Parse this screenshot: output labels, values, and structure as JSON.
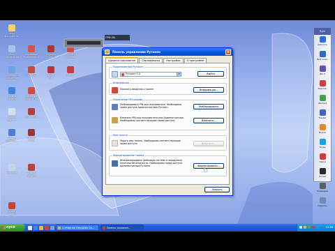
{
  "desktop_icons": [
    {
      "label": "Мои",
      "label2": "документы",
      "icon": "my-documents-icon",
      "color": "#f2d46b"
    },
    {
      "label": "Мой",
      "label2": "компьютер",
      "icon": "my-computer-icon",
      "color": "#a9c2e8"
    },
    {
      "label": "Сетевое",
      "label2": "окружение",
      "icon": "network-icon",
      "color": "#6ea3e0"
    },
    {
      "label": "Internet",
      "label2": "Explorer",
      "icon": "internet-explorer-icon",
      "color": "#3a84e6"
    },
    {
      "label": "Поиск",
      "label2": "сертиф.",
      "icon": "search-certificate-icon",
      "color": "#d9dfe7"
    },
    {
      "label": "Add or",
      "label2": "Remove...",
      "icon": "add-remove-icon",
      "color": "#4d7cd6"
    },
    {
      "label": "Корзина",
      "label2": "",
      "icon": "recycle-bin-icon",
      "color": "#c7d3e3"
    },
    {
      "label": "Rutoken",
      "label2": "Admin",
      "icon": "rutoken-icon",
      "color": "#c94236"
    },
    {
      "label": "Установка",
      "label2": "RutokenAdm",
      "icon": "rutoken-install-icon",
      "color": "#d7553e"
    },
    {
      "label": "Rutoken",
      "label2": "CSP",
      "icon": "rutoken-csp-icon",
      "color": "#a63a33"
    },
    {
      "label": "Установка",
      "label2": "КриптоПро",
      "icon": "cryptopro-icon",
      "color": "#d44a3a"
    },
    {
      "label": "Rutoken",
      "label2": "Drv",
      "icon": "rutoken-driver-icon",
      "color": "#b2383a"
    },
    {
      "label": "Сертиф.",
      "label2": "",
      "icon": "certificate-icon",
      "color": "#c44b40"
    },
    {
      "label": "КриптоПро",
      "label2": "",
      "icon": "cryptopro-csp-icon",
      "color": "#b73b3b"
    },
    {
      "label": "Rutoken",
      "label2": "PKCS",
      "icon": "rutoken-pkcs-icon",
      "color": "#9b3536"
    },
    {
      "label": "ПО для",
      "label2": "Rutoken",
      "icon": "rutoken-software-icon",
      "color": "#ba4039"
    },
    {
      "label": "Rutoken",
      "label2": "Drivers",
      "icon": "rutoken-drivers2-icon",
      "color": "#cc4d3f"
    },
    {
      "label": "PuTTY",
      "label2": "",
      "icon": "putty-icon",
      "color": "#c23c3b"
    }
  ],
  "dock": {
    "title": "Пуск",
    "items": [
      {
        "label": "Autoruns",
        "icon": "autoruns-icon",
        "color": "#2b6fd6"
      },
      {
        "label": "Мой комп.",
        "icon": "computer-icon",
        "color": "#2c69c9"
      },
      {
        "label": "Rar 3",
        "icon": "rar-icon",
        "color": "#6b4ea8"
      },
      {
        "label": "Daemon",
        "icon": "daemon-tools-icon",
        "color": "#c9423d"
      },
      {
        "label": "Utorrent",
        "icon": "utorrent-icon",
        "color": "#4aa14d"
      },
      {
        "label": "Tracker",
        "icon": "tracker-icon",
        "color": "#3e64c7"
      },
      {
        "label": "Picpick",
        "icon": "picpick-icon",
        "color": "#de8b2d"
      },
      {
        "label": "Skype",
        "icon": "skype-icon",
        "color": "#1ea0e5"
      },
      {
        "label": "Opera",
        "icon": "opera-icon",
        "color": "#d43c3c"
      },
      {
        "label": "Unreal",
        "icon": "unreal-commander-icon",
        "color": "#2a2a2a"
      },
      {
        "label": "Командир",
        "icon": "commander-icon",
        "color": "#5f5f5f"
      },
      {
        "label": "Сервисы",
        "icon": "services-icon",
        "color": "#6b8bb8"
      }
    ]
  },
  "monitor_window": {
    "label": "ГРМ ОБ"
  },
  "dialog": {
    "title": "Панель управления Рутокен",
    "close_glyph": "×",
    "tabs": [
      "Администрирование",
      "Сертификаты",
      "Настройки",
      "О программе"
    ],
    "active_tab": 0,
    "groups": {
      "readers": {
        "title": "Подключенные Рутокен",
        "selected": "Рутокен S 0",
        "logout_button": "Выйти"
      },
      "info": {
        "title": "Информация",
        "text": "Показать сведения о токене",
        "button": "Информация..."
      },
      "pin": {
        "title": "Управление PIN-кодами",
        "text1": "Разблокировать PIN-код пользователя. Необходимы права доступа Администратора Рутокен",
        "button1": "Разблокировать",
        "text2": "Изменить PIN-код пользователя или Администратора. Необходимы соответствующие права доступа",
        "button2": "Изменить..."
      },
      "name": {
        "title": "Имя токена",
        "text": "Задать имя токена. Необходимы соответствующие права доступа",
        "button": "Изменить..."
      },
      "format": {
        "title": "Форматирование токена",
        "text": "Инициализировать файловую систему и определить политики безопасности. Необходимы права доступа Администратора Рутокен",
        "button": "Форматировать..."
      }
    },
    "close_button": "Закрыть"
  },
  "taskbar": {
    "start_label": "пуск",
    "buttons": [
      {
        "label": "C:\\Program Files\\Aktiv Co...",
        "active": false
      },
      {
        "label": "Панель управлен...",
        "active": true
      }
    ],
    "clock": "12:36"
  }
}
